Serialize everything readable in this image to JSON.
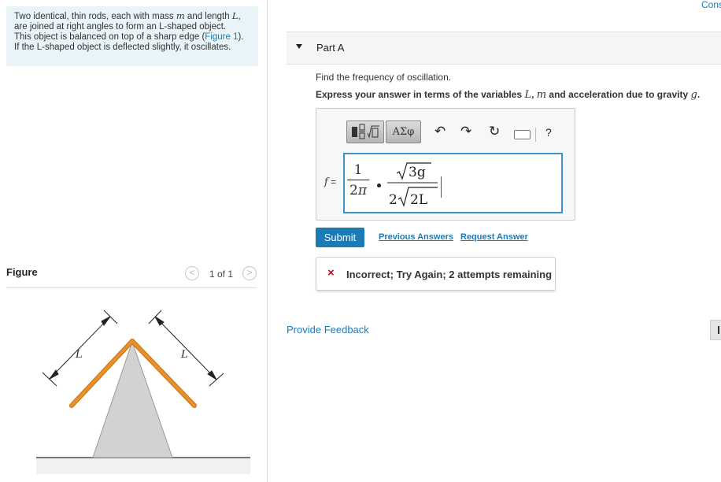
{
  "problem": {
    "line1_pre": "Two identical, thin rods, each with mass ",
    "mass_var": "m",
    "line1_mid": " and length ",
    "length_var": "L",
    "line1_post": ",",
    "line2": "are joined at right angles to form an L-shaped object.",
    "line3_pre": "This object is balanced on top of a sharp edge (",
    "figure_link": "Figure 1",
    "line3_post": ").",
    "line4": "If the L-shaped object is deflected slightly, it oscillates."
  },
  "figure": {
    "title": "Figure",
    "counter": "1 of 1",
    "prev_symbol": "<",
    "next_symbol": ">",
    "rod_label_left": "L",
    "rod_label_right": "L",
    "colors": {
      "rod": "#e8912b",
      "rod_edge": "#c86e10",
      "wedge": "#d2d2d2",
      "ground": "#777777"
    }
  },
  "header": {
    "cons_text": "Cons"
  },
  "part": {
    "label": "Part A"
  },
  "question": {
    "instruction": "Find the frequency of oscillation.",
    "express_pre": "Express your answer in terms of the variables ",
    "var_L": "L",
    "var_m": "m",
    "express_mid": " and acceleration due to gravity ",
    "var_g": "g",
    "express_post": "."
  },
  "toolbar": {
    "templates_icon": "fraction-sqrt-template-icon",
    "greek_label": "ΑΣφ",
    "undo_icon": "undo-icon",
    "redo_icon": "redo-icon",
    "reset_icon": "reset-icon",
    "keyboard_icon": "keyboard-icon",
    "help_label": "?"
  },
  "answer": {
    "var_label": "f =",
    "frac1_num": "1",
    "frac1_den_num": "2",
    "frac1_den_sym": "π",
    "sqrt_num": "3g",
    "frac2_den_coef": "2",
    "sqrt_den": "2L"
  },
  "actions": {
    "submit": "Submit",
    "previous_answers": "Previous Answers",
    "request_answer": "Request Answer"
  },
  "feedback": {
    "icon": "×",
    "message": "Incorrect; Try Again; 2 attempts remaining"
  },
  "footer": {
    "provide_feedback": "Provide Feedback"
  },
  "colors": {
    "accent": "#1b7bb5",
    "link": "#1a7cb8",
    "error": "#d0021b",
    "problem_bg": "#e8f4f8"
  }
}
